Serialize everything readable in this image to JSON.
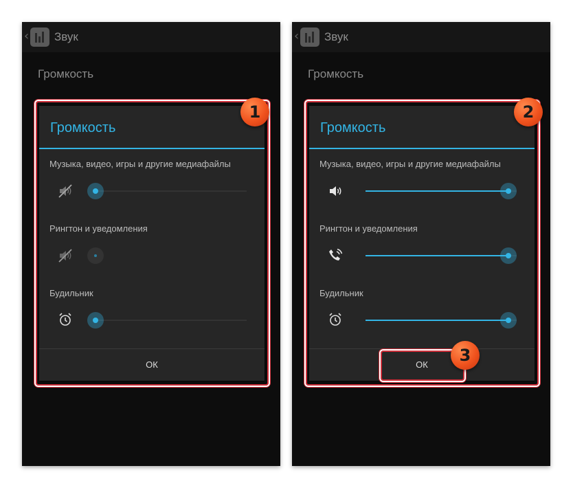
{
  "colors": {
    "accent": "#33b5e5",
    "highlight": "#cf2f3a",
    "badge": "#f0531e"
  },
  "panels": [
    {
      "app_title": "Звук",
      "section_title": "Громкость",
      "dialog": {
        "title": "Громкость",
        "ok_label": "ОК",
        "rows": [
          {
            "label": "Музыка, видео, игры и другие медиафайлы",
            "icon": "media-muted-icon",
            "level": 0.0
          },
          {
            "label": "Рингтон и уведомления",
            "icon": "ringer-muted-icon",
            "level": 0.0
          },
          {
            "label": "Будильник",
            "icon": "alarm-icon",
            "level": 0.0
          }
        ]
      },
      "badge": "1"
    },
    {
      "app_title": "Звук",
      "section_title": "Громкость",
      "dialog": {
        "title": "Громкость",
        "ok_label": "ОК",
        "rows": [
          {
            "label": "Музыка, видео, игры и другие медиафайлы",
            "icon": "speaker-icon",
            "level": 1.0
          },
          {
            "label": "Рингтон и уведомления",
            "icon": "phone-ring-icon",
            "level": 1.0
          },
          {
            "label": "Будильник",
            "icon": "alarm-icon",
            "level": 1.0
          }
        ]
      },
      "badge": "2",
      "ok_badge": "3"
    }
  ]
}
